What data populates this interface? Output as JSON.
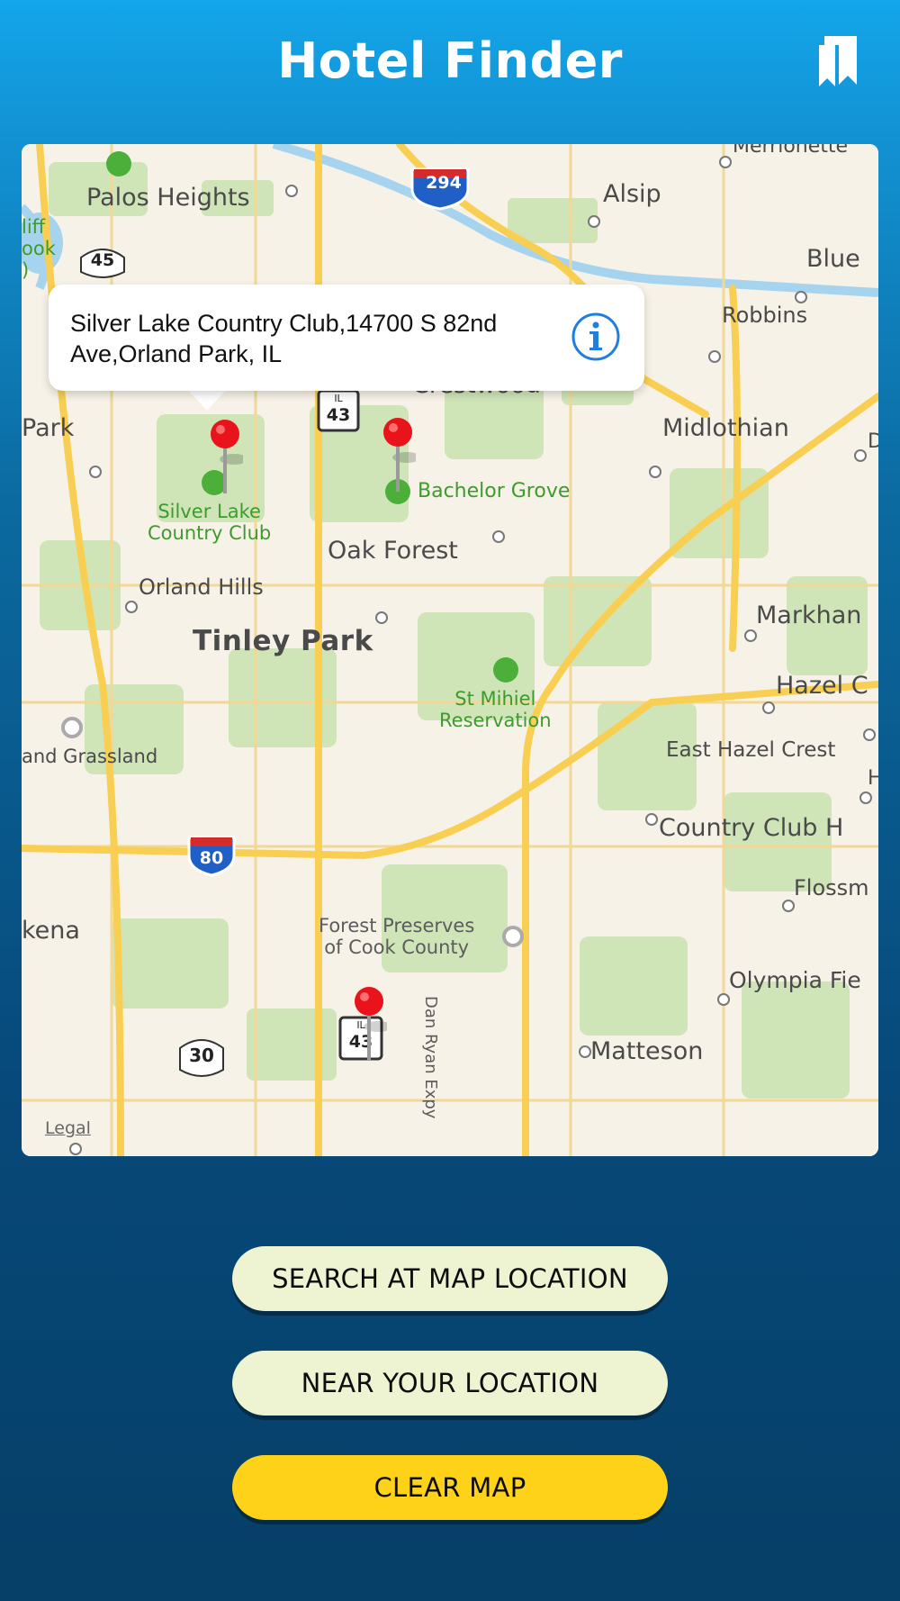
{
  "header": {
    "title": "Hotel Finder",
    "bookmark_icon": "bookmark-icon"
  },
  "map": {
    "callout": {
      "text": "Silver Lake Country Club,14700 S 82nd Ave,Orland Park, IL",
      "info_icon": "info-icon"
    },
    "labels": {
      "palos_heights": "Palos Heights",
      "alsip": "Alsip",
      "blue": "Blue",
      "robbins": "Robbins",
      "crestwood": "Crestwood",
      "midlothian": "Midlothian",
      "park_left": "Park",
      "oak_forest": "Oak Forest",
      "orland_hills": "Orland Hills",
      "tinley_park": "Tinley Park",
      "markham": "Markhan",
      "hazel": "Hazel C",
      "east_hazel_crest": "East Hazel Crest",
      "country_club_hills": "Country Club H",
      "flossmoor": "Flossm",
      "olympia_fields": "Olympia Fie",
      "matteson": "Matteson",
      "kena": "kena",
      "grassland": "and Grassland",
      "cliff_brook": "liff\nook\n)",
      "merrionette": "Merrionette",
      "d_right": "D",
      "h_right": "H",
      "silver_lake": "Silver Lake\nCountry Club",
      "bachelor_grove": "Bachelor Grove",
      "st_mihiel": "St Mihiel\nReservation",
      "forest_preserves": "Forest Preserves\nof Cook County",
      "dan_ryan": "Dan Ryan Expy",
      "legal": "Legal"
    },
    "shields": {
      "i294": "294",
      "i80": "80",
      "us45": "45",
      "us30": "30",
      "il43_top": "43",
      "il43_bottom": "43",
      "il_prefix": "IL"
    }
  },
  "buttons": {
    "search_map": "SEARCH AT MAP LOCATION",
    "near_you": "NEAR YOUR LOCATION",
    "clear_map": "CLEAR MAP"
  },
  "colors": {
    "header_top": "#13a6ea",
    "background_bottom": "#063f67",
    "button_light": "#eef3d2",
    "button_yellow": "#ffd21a",
    "pin_red": "#e8131b",
    "info_blue": "#1e7fe0"
  }
}
